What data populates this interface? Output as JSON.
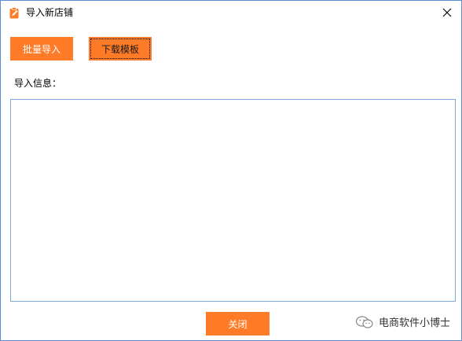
{
  "window": {
    "title": "导入新店铺",
    "icon": "clipboard-edit-icon",
    "close_icon": "close-icon"
  },
  "toolbar": {
    "batch_import_label": "批量导入",
    "download_template_label": "下载模板"
  },
  "info": {
    "label": "导入信息：",
    "content": ""
  },
  "footer": {
    "close_label": "关闭"
  },
  "watermark": {
    "text": "电商软件小博士",
    "icon": "wechat-icon"
  },
  "colors": {
    "accent": "#ff7b28",
    "window_border": "#5a8fd6",
    "textarea_border": "#7fa7d8"
  }
}
